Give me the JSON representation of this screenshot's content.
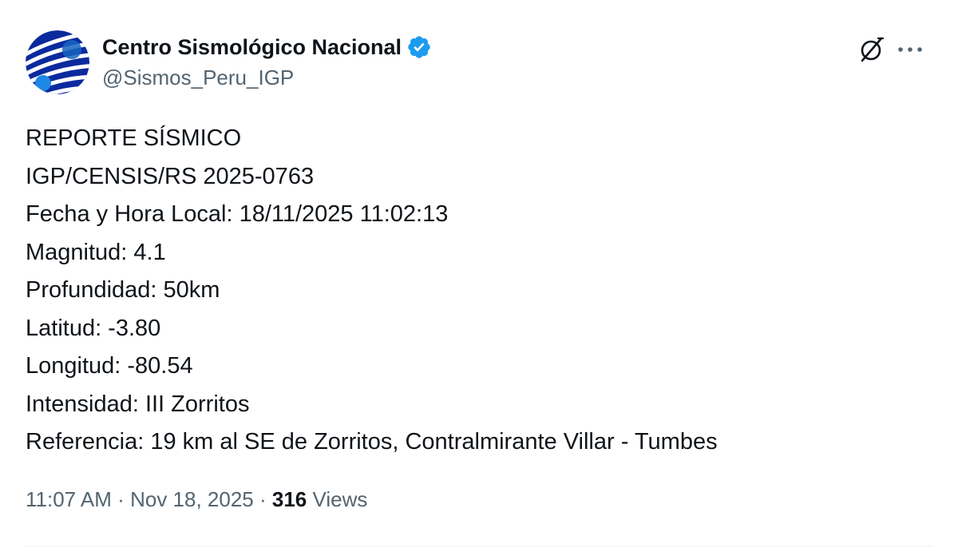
{
  "author": {
    "display_name": "Centro Sismológico Nacional",
    "handle": "@Sismos_Peru_IGP",
    "verified": true,
    "avatar_icon": "igp-logo-icon"
  },
  "actions": {
    "grok_icon": "grok-icon",
    "more_icon": "more-icon"
  },
  "post": {
    "lines": [
      "REPORTE SÍSMICO",
      "IGP/CENSIS/RS 2025-0763",
      "Fecha y Hora Local: 18/11/2025 11:02:13",
      "Magnitud: 4.1",
      "Profundidad: 50km",
      "Latitud: -3.80",
      "Longitud: -80.54",
      "Intensidad: III Zorritos",
      "Referencia: 19 km al SE de Zorritos, Contralmirante Villar - Tumbes"
    ]
  },
  "meta": {
    "time": "11:07 AM",
    "separator": "·",
    "date": "Nov 18, 2025",
    "views_count": "316",
    "views_label": "Views"
  },
  "colors": {
    "text": "#0f1419",
    "secondary": "#536471",
    "verified": "#1d9bf0",
    "avatar_bg": "#0b2a9e",
    "divider": "#eff3f4"
  }
}
